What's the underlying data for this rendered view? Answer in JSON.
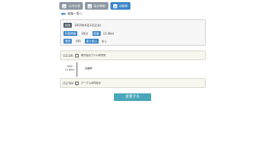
{
  "tabs": [
    {
      "label": "公共交通",
      "icon": "train-icon",
      "active": false
    },
    {
      "label": "徒歩移動",
      "icon": "walk-icon",
      "active": false
    },
    {
      "label": "自動車",
      "icon": "car-icon",
      "active": true
    }
  ],
  "back_link": {
    "label": "経路一覧へ",
    "icon": "back-arrow-icon"
  },
  "summary": {
    "date_label": "経路",
    "date_value": "2019年6月12日(水)",
    "required_time_label": "所要時間",
    "required_time_value": "26分",
    "distance_label": "距離",
    "distance_value": "11.8km",
    "fare_label": "運賃",
    "fare_value": "0円",
    "transfer_label": "乗り換え",
    "transfer_value": "なし"
  },
  "route": {
    "origin": {
      "time": "(12:24)",
      "name": "株式会社ヴァル研究所"
    },
    "segment": {
      "duration": "26分",
      "distance": "11.8km",
      "mode": "自動車"
    },
    "destination": {
      "time": "(12:50)",
      "name": "グーグル合同会社"
    }
  },
  "submit_button": {
    "label": "変更する"
  },
  "colors": {
    "accent": "#3b86c9",
    "button": "#4aa6b9",
    "inactive_tab": "#8d98a3",
    "dark_label": "#4a5564"
  }
}
